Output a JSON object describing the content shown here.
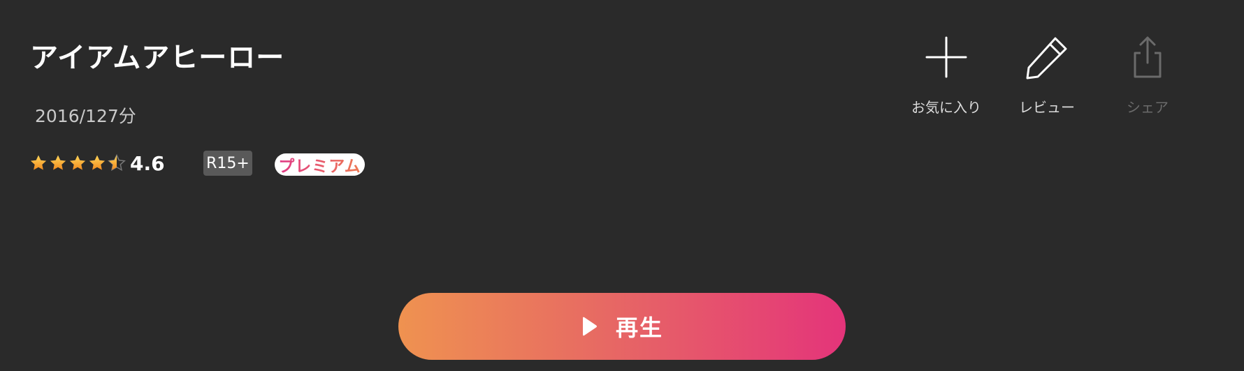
{
  "title": "アイアムアヒーロー",
  "meta": "2016/127分",
  "rating": {
    "value": "4.6",
    "stars_icon": "star-icon",
    "star_color": "#f7b731",
    "empty_star_color": "#555555"
  },
  "age_rating": "R15+",
  "premium_label": "プレミアム",
  "actions": {
    "favorite": {
      "label": "お気に入り",
      "icon": "plus-icon"
    },
    "review": {
      "label": "レビュー",
      "icon": "pencil-icon"
    },
    "share": {
      "label": "シェア",
      "icon": "share-icon",
      "disabled": true
    }
  },
  "play_button": {
    "label": "再生",
    "icon": "play-icon",
    "gradient_start": "#ef9250",
    "gradient_end": "#e4347a"
  }
}
